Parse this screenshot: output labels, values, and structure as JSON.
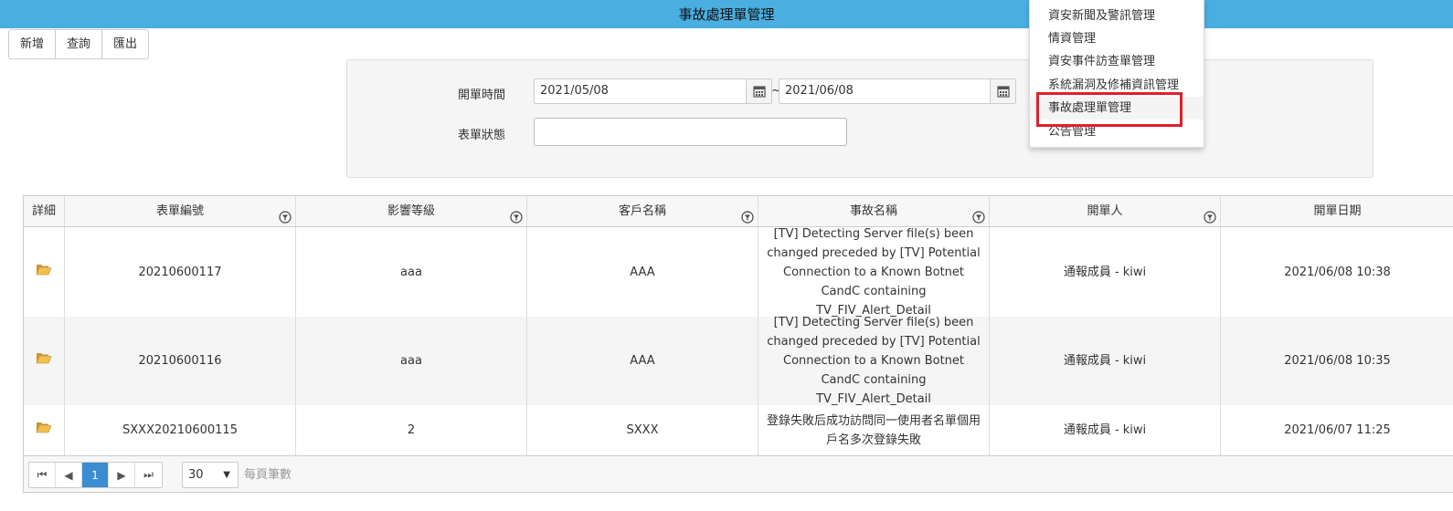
{
  "header": {
    "title": "事故處理單管理"
  },
  "toolbar": {
    "add_label": "新增",
    "query_label": "查詢",
    "export_label": "匯出"
  },
  "search": {
    "open_time_label": "開單時間",
    "date_from": "2021/05/08",
    "date_sep": "~",
    "date_to": "2021/06/08",
    "status_label": "表單狀態",
    "status_value": ""
  },
  "menu": {
    "items": [
      {
        "label": "資安新聞及警訊管理"
      },
      {
        "label": "情資管理"
      },
      {
        "label": "資安事件訪查單管理"
      },
      {
        "label": "系統漏洞及修補資訊管理"
      },
      {
        "label": "事故處理單管理"
      },
      {
        "label": "公告管理"
      }
    ],
    "active_index": 4,
    "highlight_color": "#e0202b"
  },
  "grid": {
    "columns": [
      "詳細",
      "表單編號",
      "影響等級",
      "客戶名稱",
      "事故名稱",
      "開單人",
      "開單日期"
    ],
    "rows": [
      {
        "form_no": "20210600117",
        "level": "aaa",
        "customer": "AAA",
        "incident": "[TV] Detecting Server file(s) been changed preceded by [TV] Potential Connection to a Known Botnet CandC containing TV_FIV_Alert_Detail",
        "opener": "通報成員 - kiwi",
        "date": "2021/06/08 10:38"
      },
      {
        "form_no": "20210600116",
        "level": "aaa",
        "customer": "AAA",
        "incident": "[TV] Detecting Server file(s) been changed preceded by [TV] Potential Connection to a Known Botnet CandC containing TV_FIV_Alert_Detail",
        "opener": "通報成員 - kiwi",
        "date": "2021/06/08 10:35"
      },
      {
        "form_no": "SXXX20210600115",
        "level": "2",
        "customer": "SXXX",
        "incident": "登錄失敗后成功訪問同一使用者名單個用戶名多次登錄失敗",
        "opener": "通報成員 - kiwi",
        "date": "2021/06/07 11:25"
      }
    ]
  },
  "pager": {
    "current_page": "1",
    "page_size": "30",
    "page_size_label": "每頁筆數"
  },
  "colors": {
    "header_bg": "#4aaee0",
    "pager_active": "#3a8dd0"
  }
}
